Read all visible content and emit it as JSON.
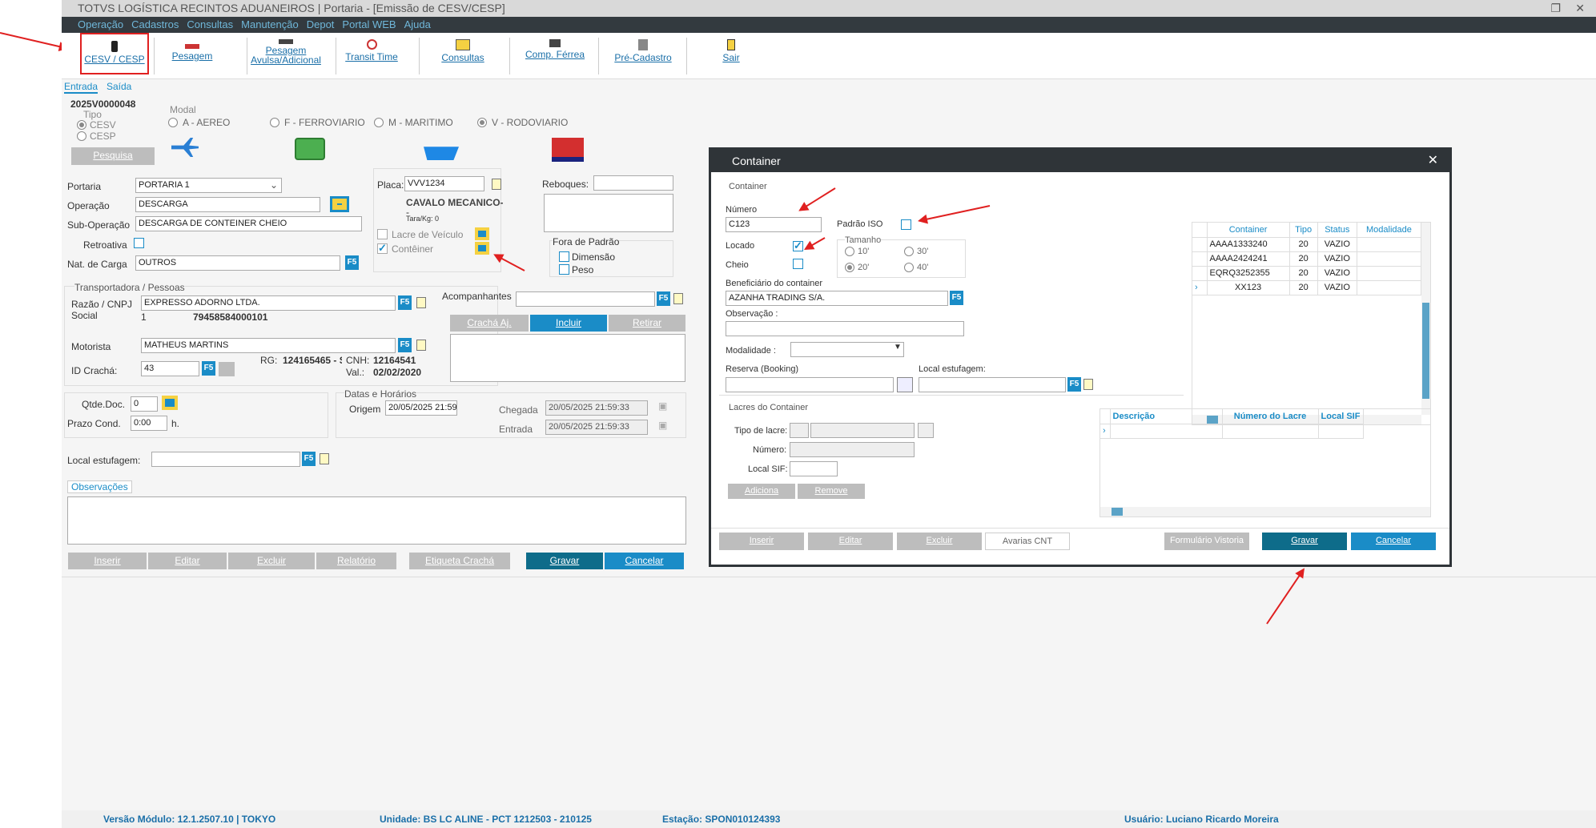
{
  "window": {
    "title": "TOTVS LOGÍSTICA RECINTOS ADUANEIROS | Portaria - [Emissão de CESV/CESP]"
  },
  "menu": [
    "Operação",
    "Cadastros",
    "Consultas",
    "Manutenção",
    "Depot",
    "Portal WEB",
    "Ajuda"
  ],
  "toolbar": [
    {
      "label": "CESV / CESP",
      "icon": "traffic-light-icon"
    },
    {
      "label": "Pesagem",
      "icon": "scale-icon"
    },
    {
      "label": "Pesagem Avulsa/Adicional",
      "icon": "scale-icon"
    },
    {
      "label": "Transit Time",
      "icon": "clock-icon"
    },
    {
      "label": "Consultas",
      "icon": "printer-icon"
    },
    {
      "label": "Comp. Férrea",
      "icon": "train-icon"
    },
    {
      "label": "Pré-Cadastro",
      "icon": "form-icon"
    },
    {
      "label": "Sair",
      "icon": "exit-door-icon"
    }
  ],
  "tabs": {
    "entrada": "Entrada",
    "saida": "Saída"
  },
  "form": {
    "code": "2025V0000048",
    "tipo_label": "Tipo",
    "cesv": "CESV",
    "cesp": "CESP",
    "pesquisa": "Pesquisa",
    "modal_label": "Modal",
    "modal_a": "A - AEREO",
    "modal_f": "F - FERROVIARIO",
    "modal_m": "M - MARITIMO",
    "modal_v": "V - RODOVIARIO",
    "portaria_label": "Portaria",
    "portaria": "PORTARIA 1",
    "operacao_label": "Operação",
    "operacao": "DESCARGA",
    "subop_label": "Sub-Operação",
    "subop": "DESCARGA DE CONTEINER CHEIO",
    "retroativa_label": "Retroativa",
    "natcarga_label": "Nat. de Carga",
    "natcarga": "OUTROS",
    "placa_label": "Placa:",
    "placa": "VVV1234",
    "veiculo": "CAVALO MECANICO-",
    "veiculo2": "-",
    "tara": "Tara/Kg: 0",
    "lacre_veiculo": "Lacre de Veículo",
    "conteiner": "Contêiner",
    "reboques_label": "Reboques:",
    "fora_padrao": "Fora de Padrão",
    "dimensao": "Dimensão",
    "peso": "Peso",
    "transp_title": "Transportadora / Pessoas",
    "razao_label": "Razão / CNPJ",
    "social_label": "Social",
    "razao": "EXPRESSO ADORNO LTDA.",
    "cnpj_idx": "1",
    "cnpj": "79458584000101",
    "acomp_label": "Acompanhantes",
    "cracha_aj": "Crachá Aj.",
    "incluir": "Incluir",
    "retirar": "Retirar",
    "motorista_label": "Motorista",
    "motorista": "MATHEUS MARTINS",
    "idcracha_label": "ID Crachá:",
    "idcracha": "43",
    "rg_label": "RG:",
    "rg": "124165465 - S",
    "cnh_label": "CNH:",
    "cnh": "12164541",
    "val_label": "Val.:",
    "val": "02/02/2020",
    "qtde_label": "Qtde.Doc.",
    "qtde": "0",
    "prazo_label": "Prazo Cond.",
    "prazo": "0:00",
    "h": "h.",
    "datas_title": "Datas e Horários",
    "origem_label": "Origem",
    "origem": "20/05/2025 21:59",
    "chegada_label": "Chegada",
    "chegada": "20/05/2025 21:59:33",
    "entrada_label": "Entrada",
    "entrada": "20/05/2025 21:59:33",
    "localest_label": "Local estufagem:",
    "obs_tab": "Observações"
  },
  "bottom_buttons": {
    "inserir": "Inserir",
    "editar": "Editar",
    "excluir": "Excluir",
    "relatorio": "Relatório",
    "etiqueta": "Etiqueta Crachá",
    "gravar": "Gravar",
    "cancelar": "Cancelar"
  },
  "status": {
    "versao": "Versão Módulo:  12.1.2507.10  |  TOKYO",
    "unidade": "Unidade: BS LC ALINE - PCT 1212503 - 210125",
    "estacao": "Estação: SPON010124393",
    "usuario": "Usuário: Luciano Ricardo Moreira"
  },
  "dialog": {
    "title": "Container",
    "group": "Container",
    "numero_label": "Número",
    "numero": "C123",
    "padrao_iso": "Padrão ISO",
    "locado": "Locado",
    "cheio": "Cheio",
    "tamanho": "Tamanho",
    "t10": "10'",
    "t20": "20'",
    "t30": "30'",
    "t40": "40'",
    "benef_label": "Beneficiário do container",
    "benef": "AZANHA TRADING S/A.",
    "obs_label": "Observação :",
    "modalidade_label": "Modalidade :",
    "reserva_label": "Reserva (Booking)",
    "localest_label": "Local estufagem:",
    "grid_headers": [
      "Container",
      "Tipo",
      "Status",
      "Modalidade"
    ],
    "grid_rows": [
      [
        "AAAA1333240",
        "20",
        "VAZIO",
        ""
      ],
      [
        "AAAA2424241",
        "20",
        "VAZIO",
        ""
      ],
      [
        "EQRQ3252355",
        "20",
        "VAZIO",
        ""
      ],
      [
        "XX123",
        "20",
        "VAZIO",
        ""
      ]
    ],
    "lacres_title": "Lacres do Container",
    "tipo_lacre": "Tipo de lacre:",
    "numero2": "Número:",
    "local_sif": "Local SIF:",
    "adiciona": "Adiciona",
    "remove": "Remove",
    "lacres_headers": [
      "Descrição",
      "Número do Lacre",
      "Local SIF"
    ],
    "btns": {
      "inserir": "Inserir",
      "editar": "Editar",
      "excluir": "Excluir",
      "avarias": "Avarias CNT",
      "formulario": "Formulário Vistoria",
      "gravar": "Gravar",
      "cancelar": "Cancelar"
    }
  },
  "colors": {
    "accent": "#1a8cc7",
    "annotation": "#e02020",
    "dark": "#2f3438"
  }
}
